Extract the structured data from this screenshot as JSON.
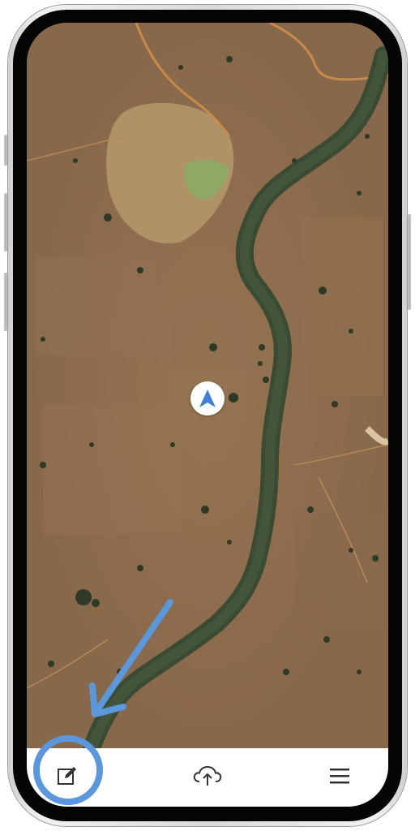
{
  "device": {
    "type": "smartphone"
  },
  "map": {
    "layer": "satellite",
    "features": [
      "river",
      "reservoir",
      "dirt-roads",
      "trees",
      "fields"
    ],
    "location_marker": "navigation-arrow-icon"
  },
  "bottom_nav": {
    "items": [
      {
        "name": "edit",
        "icon": "edit-note-icon"
      },
      {
        "name": "upload",
        "icon": "cloud-upload-icon"
      },
      {
        "name": "menu",
        "icon": "hamburger-menu-icon"
      }
    ]
  },
  "annotation": {
    "color": "#5b97db",
    "target": "edit-button",
    "shapes": [
      "arrow",
      "circle"
    ]
  },
  "colors": {
    "accent": "#3f7fd4",
    "annotation": "#5b97db",
    "nav_background": "#ffffff",
    "icon": "#333333"
  }
}
